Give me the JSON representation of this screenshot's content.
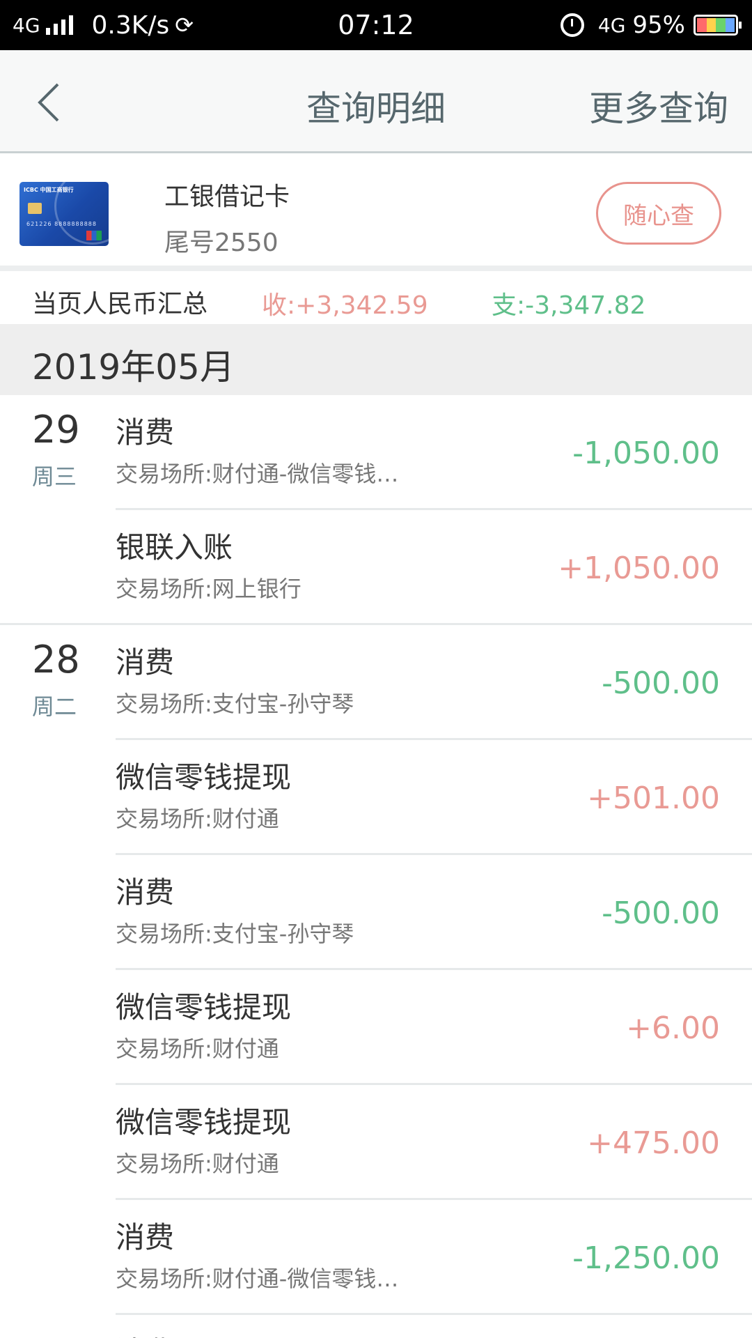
{
  "status_bar": {
    "network_left": "4G",
    "speed": "0.3K/s",
    "sync_icon": "sync-icon",
    "time": "07:12",
    "network_right": "4G",
    "battery": "95%"
  },
  "nav": {
    "back_icon": "chevron-left-icon",
    "title": "查询明细",
    "more": "更多查询"
  },
  "card": {
    "bank_name": "工银借记卡",
    "tail": "尾号2550",
    "image_text_top": "ICBC 中国工商银行",
    "image_number": "621226 8888888888",
    "button": "随心查"
  },
  "summary": {
    "label": "当页人民币汇总",
    "income": "收:+3,342.59",
    "expense": "支:-3,347.82"
  },
  "month": "2019年05月",
  "groups": [
    {
      "day": "29",
      "weekday": "周三",
      "items": [
        {
          "title": "消费",
          "place": "交易场所:财付通-微信零钱…",
          "amount": "-1,050.00"
        },
        {
          "title": "银联入账",
          "place": "交易场所:网上银行",
          "amount": "+1,050.00"
        }
      ]
    },
    {
      "day": "28",
      "weekday": "周二",
      "items": [
        {
          "title": "消费",
          "place": "交易场所:支付宝-孙守琴",
          "amount": "-500.00"
        },
        {
          "title": "微信零钱提现",
          "place": "交易场所:财付通",
          "amount": "+501.00"
        },
        {
          "title": "消费",
          "place": "交易场所:支付宝-孙守琴",
          "amount": "-500.00"
        },
        {
          "title": "微信零钱提现",
          "place": "交易场所:财付通",
          "amount": "+6.00"
        },
        {
          "title": "微信零钱提现",
          "place": "交易场所:财付通",
          "amount": "+475.00"
        },
        {
          "title": "消费",
          "place": "交易场所:财付通-微信零钱…",
          "amount": "-1,250.00"
        },
        {
          "title": "消费",
          "place": "",
          "amount": ""
        }
      ]
    }
  ],
  "colors": {
    "income": "#e99a94",
    "expense": "#5fbf8a",
    "nav_text": "#56676d",
    "month_bg": "#eeeeee"
  }
}
